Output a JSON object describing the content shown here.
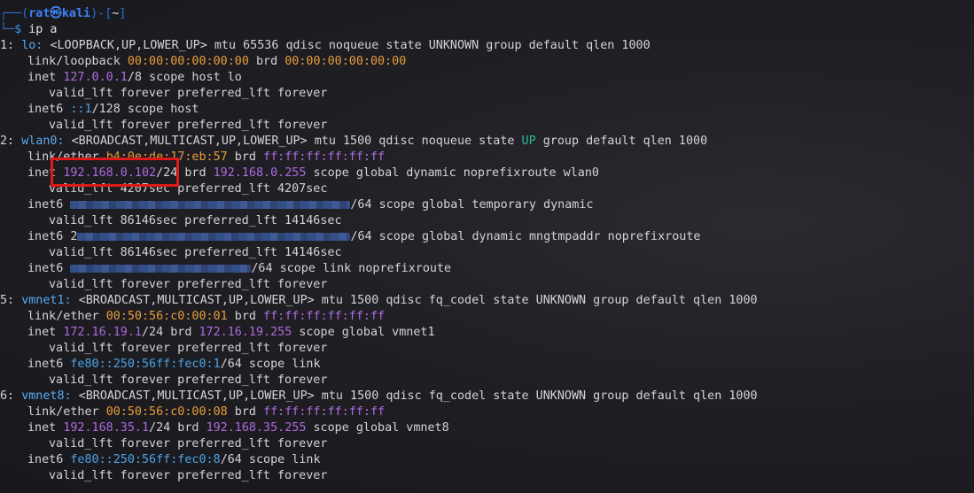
{
  "prompt": {
    "frame_top": "┌──(",
    "user": "rat㉿kali",
    "frame_mid": ")-[",
    "dir": "~",
    "frame_end": "]",
    "frame_bottom": "└─",
    "symbol": "$",
    "command": " ip a"
  },
  "iface1": {
    "num": "1:",
    "name": "lo:",
    "flags": "<LOOPBACK,UP,LOWER_UP> mtu 65536 qdisc noqueue state UNKNOWN group default qlen 1000",
    "link_prefix": "link/loopback ",
    "mac": "00:00:00:00:00:00",
    "brd_label": " brd ",
    "brd": "00:00:00:00:00:00",
    "inet_label": "inet ",
    "inet": "127.0.0.1",
    "inet_rest": "/8 scope host lo",
    "valid1": "valid_lft forever preferred_lft forever",
    "inet6_label": "inet6 ",
    "inet6": "::1",
    "inet6_rest": "/128 scope host",
    "valid2": "valid_lft forever preferred_lft forever"
  },
  "iface2": {
    "num": "2:",
    "name": "wlan0:",
    "flags_a": "<BROADCAST,MULTICAST,UP,LOWER_UP> mtu 1500 qdisc noqueue state ",
    "state": "UP",
    "flags_b": " group default qlen 1000",
    "link_prefix": "link/ether ",
    "mac": "b4:0e:de:17:eb:57",
    "brd_label": " brd ",
    "brd": "ff:ff:ff:ff:ff:ff",
    "inet_label": "inet ",
    "inet": "192.168.0.102",
    "inet_mask": "/24",
    "inet_brd_label": " brd ",
    "inet_brd": "192.168.0.255",
    "inet_rest": " scope global dynamic noprefixroute wlan0",
    "valid1": "valid_lft 4207sec preferred_lft 4207sec",
    "inet6a_label": "inet6 ",
    "inet6a_rest": "/64 scope global temporary dynamic",
    "valid2": "valid_lft 86146sec preferred_lft 14146sec",
    "inet6b_label": "inet6 2",
    "inet6b_rest": "/64 scope global dynamic mngtmpaddr noprefixroute",
    "valid3": "valid_lft 86146sec preferred_lft 14146sec",
    "inet6c_label": "inet6 ",
    "inet6c_rest": "/64 scope link noprefixroute",
    "valid4": "valid_lft forever preferred_lft forever"
  },
  "iface5": {
    "num": "5:",
    "name": "vmnet1:",
    "flags": "<BROADCAST,MULTICAST,UP,LOWER_UP> mtu 1500 qdisc fq_codel state UNKNOWN group default qlen 1000",
    "link_prefix": "link/ether ",
    "mac": "00:50:56:c0:00:01",
    "brd_label": " brd ",
    "brd": "ff:ff:ff:ff:ff:ff",
    "inet_label": "inet ",
    "inet": "172.16.19.1",
    "inet_mask": "/24 brd ",
    "inet_brd": "172.16.19.255",
    "inet_rest": " scope global vmnet1",
    "valid1": "valid_lft forever preferred_lft forever",
    "inet6_label": "inet6 ",
    "inet6": "fe80::250:56ff:fec0:1",
    "inet6_rest": "/64 scope link",
    "valid2": "valid_lft forever preferred_lft forever"
  },
  "iface6": {
    "num": "6:",
    "name": "vmnet8:",
    "flags": "<BROADCAST,MULTICAST,UP,LOWER_UP> mtu 1500 qdisc fq_codel state UNKNOWN group default qlen 1000",
    "link_prefix": "link/ether ",
    "mac": "00:50:56:c0:00:08",
    "brd_label": " brd ",
    "brd": "ff:ff:ff:ff:ff:ff",
    "inet_label": "inet ",
    "inet": "192.168.35.1",
    "inet_mask": "/24 brd ",
    "inet_brd": "192.168.35.255",
    "inet_rest": " scope global vmnet8",
    "valid1": "valid_lft forever preferred_lft forever",
    "inet6_label": "inet6 ",
    "inet6": "fe80::250:56ff:fec0:8",
    "inet6_rest": "/64 scope link",
    "valid2": "valid_lft forever preferred_lft forever"
  }
}
